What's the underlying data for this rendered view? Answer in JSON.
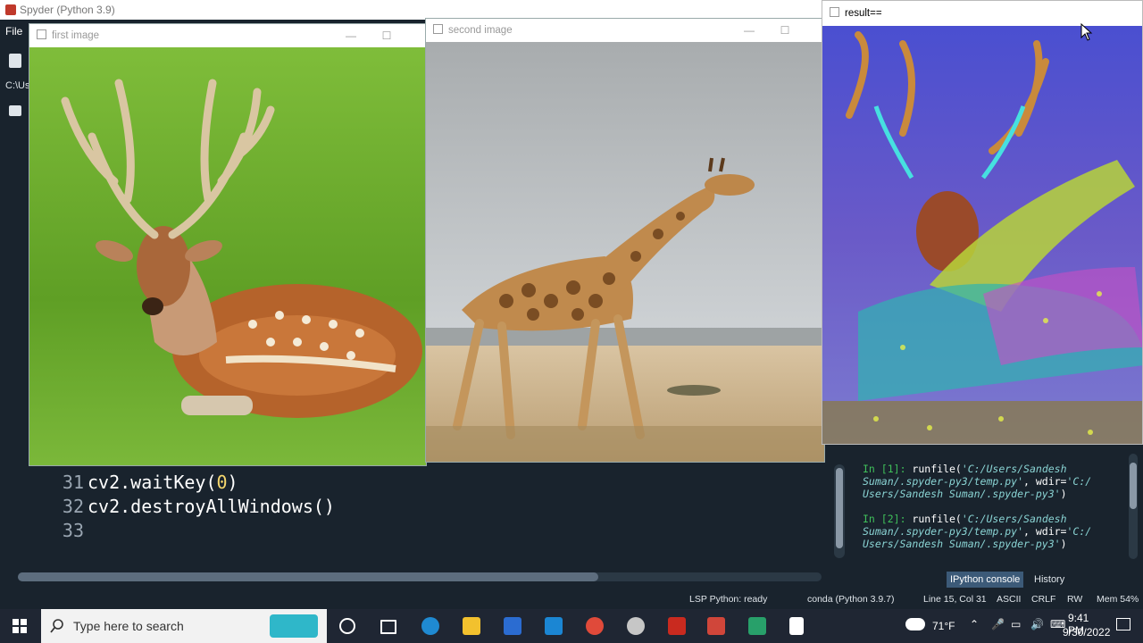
{
  "spyder": {
    "title": "Spyder (Python 3.9)",
    "menu_file": "File",
    "path_fragment": "C:\\Us",
    "editor_lines": [
      {
        "num": "31",
        "pre": "cv2.waitKey(",
        "arg": "0",
        "post": ")"
      },
      {
        "num": "32",
        "pre": "cv2.destroyAllWindows()",
        "arg": "",
        "post": ""
      },
      {
        "num": "33",
        "pre": "",
        "arg": "",
        "post": ""
      }
    ],
    "console": [
      {
        "prompt": "In [",
        "n": "1",
        "close": "]:",
        "cmd": " runfile(",
        "arg1": "'C:/Users/Sandesh",
        "line2": "Suman/.spyder-py3/temp.py'",
        "sep": ", wdir=",
        "arg2": "'C:/",
        "line3": "Users/Sandesh Suman/.spyder-py3'",
        "end": ")"
      },
      {
        "prompt": "In [",
        "n": "2",
        "close": "]:",
        "cmd": " runfile(",
        "arg1": "'C:/Users/Sandesh",
        "line2": "Suman/.spyder-py3/temp.py'",
        "sep": ", wdir=",
        "arg2": "'C:/",
        "line3": "Users/Sandesh Suman/.spyder-py3'",
        "end": ")"
      }
    ],
    "console_tabs": [
      "IPython console",
      "History"
    ],
    "status": {
      "lsp": "LSP Python: ready",
      "conda": "conda (Python 3.9.7)",
      "position": "Line 15, Col 31",
      "encoding": "ASCII",
      "eol": "CRLF",
      "rw": "RW",
      "mem": "Mem 54%"
    }
  },
  "windows": {
    "first": {
      "title": "first image"
    },
    "second": {
      "title": "second image"
    },
    "result": {
      "title": "result=="
    }
  },
  "taskbar": {
    "search_placeholder": "Type here to search",
    "weather": "71°F",
    "time": "9:41 PM",
    "date": "9/30/2022"
  },
  "colors": {
    "spyder_bg": "#19232d",
    "console_green": "#3fbf5a",
    "taskbar_bg": "#1f2633"
  }
}
